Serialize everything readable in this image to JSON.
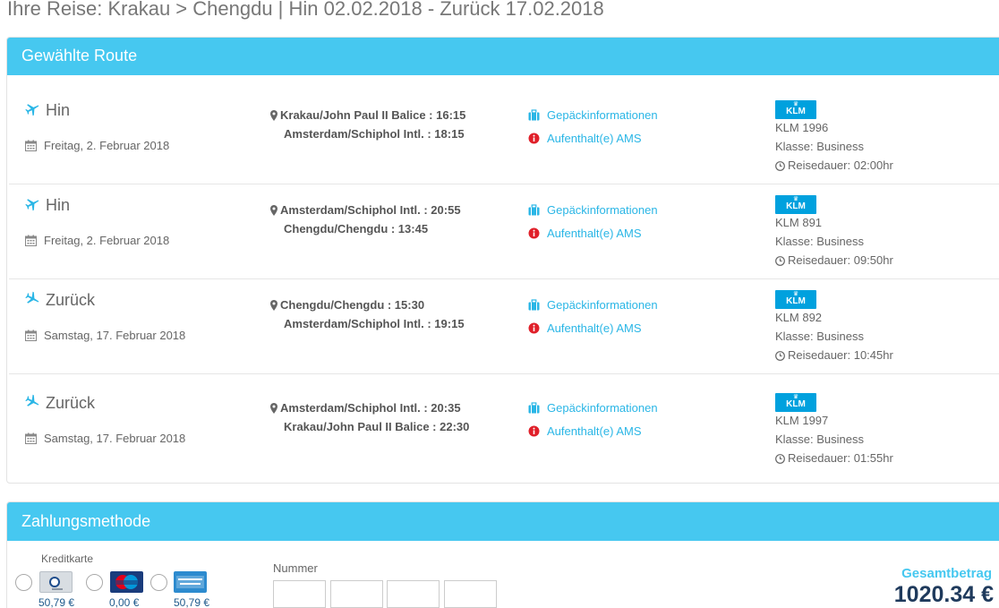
{
  "page_title": "Ihre Reise: Krakau > Chengdu | Hin 02.02.2018 - Zurück 17.02.2018",
  "route": {
    "heading": "Gewählte Route",
    "segments": [
      {
        "direction": "Hin",
        "date": "Freitag, 2. Februar 2018",
        "from": "Krakau/John Paul II Balice : 16:15",
        "to": "Amsterdam/Schiphol Intl. : 18:15",
        "baggage": "Gepäckinformationen",
        "stopover": "Aufenthalt(e) AMS",
        "airline_logo": "KLM",
        "flight": "KLM 1996",
        "class": "Klasse: Business",
        "duration": "Reisedauer: 02:00hr"
      },
      {
        "direction": "Hin",
        "date": "Freitag, 2. Februar 2018",
        "from": "Amsterdam/Schiphol Intl. : 20:55",
        "to": "Chengdu/Chengdu : 13:45",
        "baggage": "Gepäckinformationen",
        "stopover": "Aufenthalt(e) AMS",
        "airline_logo": "KLM",
        "flight": "KLM 891",
        "class": "Klasse: Business",
        "duration": "Reisedauer: 09:50hr"
      },
      {
        "direction": "Zurück",
        "date": "Samstag, 17. Februar 2018",
        "from": "Chengdu/Chengdu : 15:30",
        "to": "Amsterdam/Schiphol Intl. : 19:15",
        "baggage": "Gepäckinformationen",
        "stopover": "Aufenthalt(e) AMS",
        "airline_logo": "KLM",
        "flight": "KLM 892",
        "class": "Klasse: Business",
        "duration": "Reisedauer: 10:45hr"
      },
      {
        "direction": "Zurück",
        "date": "Samstag, 17. Februar 2018",
        "from": "Amsterdam/Schiphol Intl. : 20:35",
        "to": "Krakau/John Paul II Balice : 22:30",
        "baggage": "Gepäckinformationen",
        "stopover": "Aufenthalt(e) AMS",
        "airline_logo": "KLM",
        "flight": "KLM 1997",
        "class": "Klasse: Business",
        "duration": "Reisedauer: 01:55hr"
      }
    ]
  },
  "payment": {
    "heading": "Zahlungsmethode",
    "card_label": "Kreditkarte",
    "cards": [
      {
        "name": "diners-club-card",
        "fee": "50,79 €"
      },
      {
        "name": "maestro-card",
        "fee": "0,00 €"
      },
      {
        "name": "american-express-card",
        "fee": "50,79 €"
      }
    ],
    "number_label": "Nummer",
    "total_label": "Gesamtbetrag",
    "total_value": "1020.34 €"
  },
  "colors": {
    "accent": "#46c8f0",
    "link": "#2ab6e6",
    "klm_blue": "#00a1de",
    "stopover_red": "#e0202a",
    "total_text": "#1f3a5c"
  },
  "icons": {
    "outbound": "plane-departure-icon",
    "return": "plane-arrival-icon",
    "date": "calendar-icon",
    "location": "map-pin-icon",
    "baggage": "suitcase-icon",
    "stopover": "info-icon",
    "duration": "clock-icon"
  }
}
